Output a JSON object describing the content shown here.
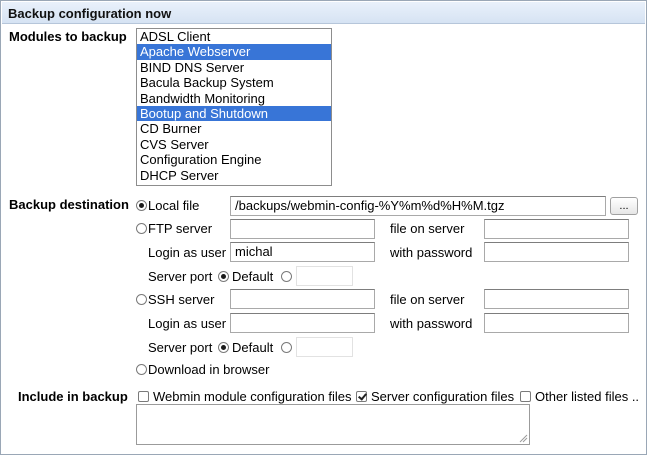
{
  "header": {
    "title": "Backup configuration now"
  },
  "modules": {
    "label": "Modules to backup",
    "options": [
      {
        "label": "ADSL Client",
        "selected": false
      },
      {
        "label": "Apache Webserver",
        "selected": true
      },
      {
        "label": "BIND DNS Server",
        "selected": false
      },
      {
        "label": "Bacula Backup System",
        "selected": false
      },
      {
        "label": "Bandwidth Monitoring",
        "selected": false
      },
      {
        "label": "Bootup and Shutdown",
        "selected": true
      },
      {
        "label": "CD Burner",
        "selected": false
      },
      {
        "label": "CVS Server",
        "selected": false
      },
      {
        "label": "Configuration Engine",
        "selected": false
      },
      {
        "label": "DHCP Server",
        "selected": false
      }
    ]
  },
  "destination": {
    "label": "Backup destination",
    "local": {
      "label": "Local file",
      "value": "/backups/webmin-config-%Y%m%d%H%M.tgz",
      "browse_label": "..."
    },
    "ftp": {
      "label": "FTP server",
      "server_value": "",
      "file_label": "file on server",
      "file_value": "",
      "login_label": "Login as user",
      "login_value": "michal",
      "password_label": "with password",
      "password_value": "",
      "port_label": "Server port",
      "default_label": "Default",
      "port_value": ""
    },
    "ssh": {
      "label": "SSH server",
      "server_value": "",
      "file_label": "file on server",
      "file_value": "",
      "login_label": "Login as user",
      "login_value": "",
      "password_label": "with password",
      "password_value": "",
      "port_label": "Server port",
      "default_label": "Default",
      "port_value": ""
    },
    "download": {
      "label": "Download in browser"
    },
    "selected": "local"
  },
  "include": {
    "label": "Include in backup",
    "webmin_label": "Webmin module configuration files",
    "webmin_checked": false,
    "server_label": "Server configuration files",
    "server_checked": true,
    "other_label": "Other listed files ..",
    "other_checked": false,
    "files_value": ""
  },
  "colors": {
    "selection": "#3875d7",
    "header_bg": "#dfe9f6",
    "border": "#9aa7b6"
  }
}
